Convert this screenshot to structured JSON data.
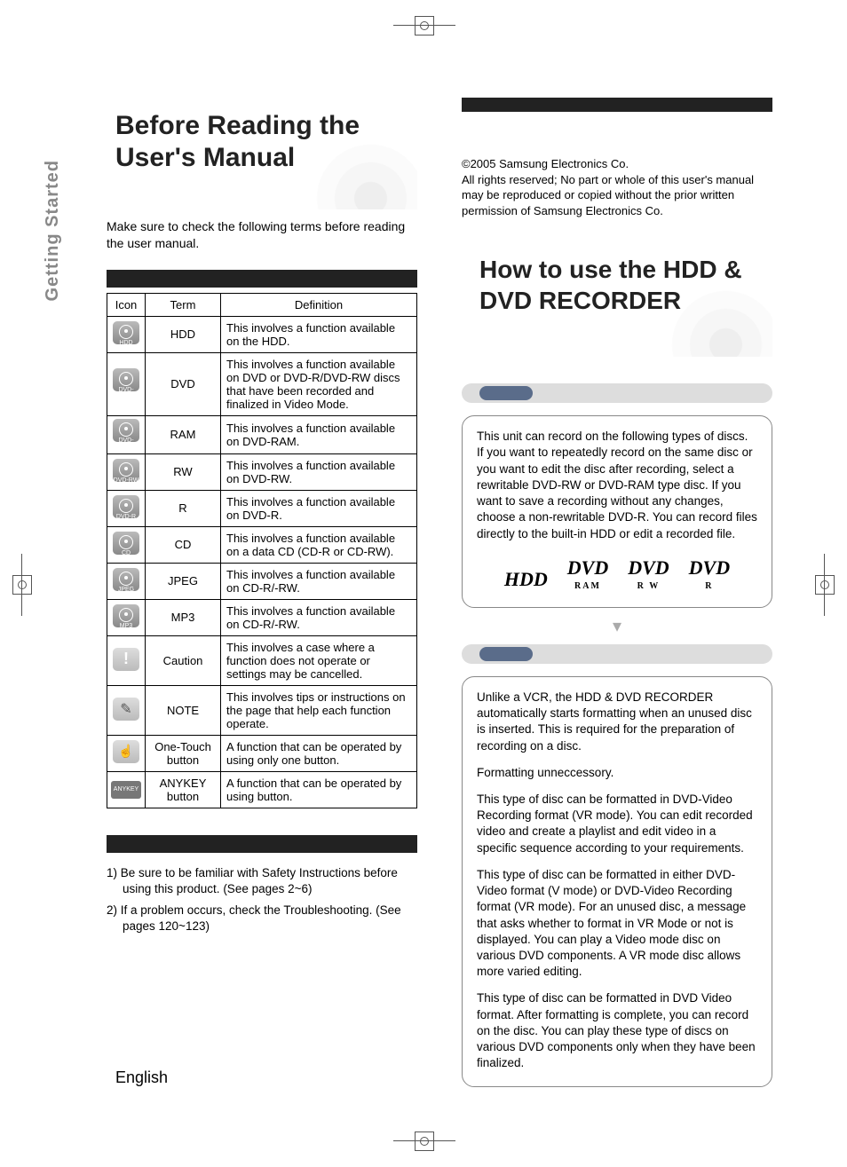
{
  "side_tab": "Getting Started",
  "left": {
    "title": "Before Reading the User's Manual",
    "intro": "Make sure to check the following terms before reading the user manual.",
    "table_headers": {
      "icon": "Icon",
      "term": "Term",
      "definition": "Definition"
    },
    "rows": [
      {
        "icon_label": "HDD",
        "term": "HDD",
        "definition": "This involves a function available on the HDD."
      },
      {
        "icon_label": "DVD-VIDEO",
        "term": "DVD",
        "definition": "This involves a function available on DVD or DVD-R/DVD-RW discs that have been recorded and finalized in Video Mode."
      },
      {
        "icon_label": "DVD-RAM",
        "term": "RAM",
        "definition": "This involves a function available on DVD-RAM."
      },
      {
        "icon_label": "DVD-RW",
        "term": "RW",
        "definition": "This involves a function available on DVD-RW."
      },
      {
        "icon_label": "DVD-R",
        "term": "R",
        "definition": "This involves a function available on DVD-R."
      },
      {
        "icon_label": "CD",
        "term": "CD",
        "definition": "This involves a function available on a data CD (CD-R or CD-RW)."
      },
      {
        "icon_label": "JPEG",
        "term": "JPEG",
        "definition": "This involves a function available on CD-R/-RW."
      },
      {
        "icon_label": "MP3",
        "term": "MP3",
        "definition": "This involves a function available on CD-R/-RW."
      },
      {
        "icon_label": "!",
        "term": "Caution",
        "definition": "This involves a case where a function does not operate or settings may be cancelled."
      },
      {
        "icon_label": "✎",
        "term": "NOTE",
        "definition": "This involves tips or instructions on the page that help each function operate."
      },
      {
        "icon_label": "☝",
        "term": "One-Touch button",
        "definition": "A function that can be operated by using only one button."
      },
      {
        "icon_label": "ANYKEY",
        "term": "ANYKEY button",
        "definition": "A function that can be operated by using             button."
      }
    ],
    "notes": [
      "1) Be sure to be familiar with Safety Instructions before using this product. (See pages 2~6)",
      "2) If a problem occurs, check the Troubleshooting. (See pages 120~123)"
    ],
    "footer": "English"
  },
  "right": {
    "copyright": "©2005 Samsung Electronics Co.\nAll rights reserved; No part or whole of this user's manual may be reproduced or copied without the prior written permission of Samsung Electronics Co.",
    "title": "How to use the HDD & DVD RECORDER",
    "box1": {
      "text": "This unit can record on the following types of discs. If you want to repeatedly record on the same disc or you want to edit the disc after recording, select a rewritable DVD-RW or DVD-RAM type disc. If you want to save a recording without any changes, choose a non-rewritable DVD-R. You can record files directly to the built-in HDD or edit a recorded file.",
      "logos": [
        "HDD",
        "RAM",
        "R W",
        "R"
      ]
    },
    "box2": {
      "p1": "Unlike a VCR, the HDD & DVD RECORDER automatically starts formatting when an unused disc is inserted. This is required for the preparation of recording on a disc.",
      "p2": "Formatting unneccessory.",
      "p3": "This type of disc can be formatted in DVD-Video Recording format (VR mode). You can edit recorded video and create a playlist and edit video in a specific sequence according to your requirements.",
      "p4": "This type of disc can be formatted in either DVD-Video format (V mode) or DVD-Video Recording format (VR mode). For an unused disc, a message that asks whether to format in VR Mode or not is displayed. You can play a Video mode disc on various DVD components. A VR mode disc allows more varied editing.",
      "p5": "This type of disc can be formatted in DVD Video format. After formatting is complete, you can record on the disc. You can play these type of discs on various DVD components only when they have been finalized."
    }
  }
}
